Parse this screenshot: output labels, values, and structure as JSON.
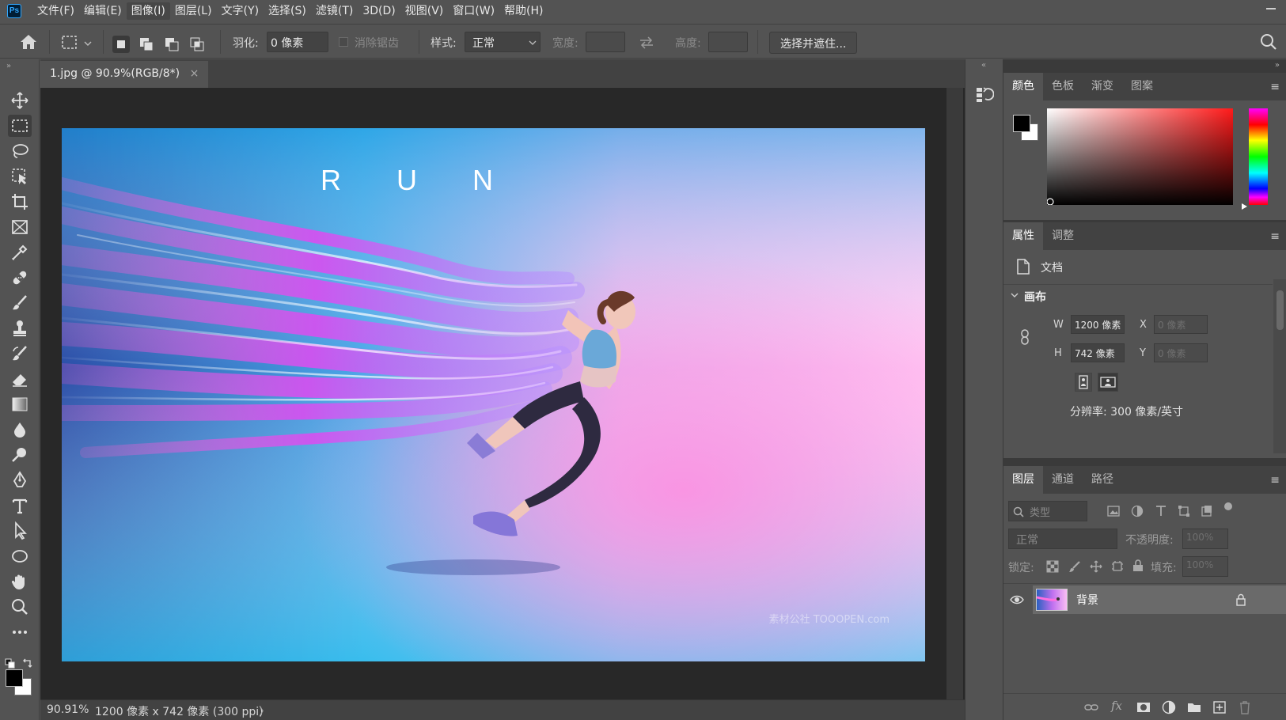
{
  "menu": [
    {
      "label": "文件(F)",
      "active": false
    },
    {
      "label": "编辑(E)",
      "active": false
    },
    {
      "label": "图像(I)",
      "active": true
    },
    {
      "label": "图层(L)",
      "active": false
    },
    {
      "label": "文字(Y)",
      "active": false
    },
    {
      "label": "选择(S)",
      "active": false
    },
    {
      "label": "滤镜(T)",
      "active": false
    },
    {
      "label": "3D(D)",
      "active": false
    },
    {
      "label": "视图(V)",
      "active": false
    },
    {
      "label": "窗口(W)",
      "active": false
    },
    {
      "label": "帮助(H)",
      "active": false
    }
  ],
  "app": {
    "logo": "Ps"
  },
  "options": {
    "feather_label": "羽化:",
    "feather_value": "0 像素",
    "antialias_label": "消除锯齿",
    "style_label": "样式:",
    "style_value": "正常",
    "width_label": "宽度:",
    "height_label": "高度:",
    "select_mask_button": "选择并遮住..."
  },
  "document": {
    "tab_title": "1.jpg @ 90.9%(RGB/8*)",
    "close_glyph": "×",
    "image": {
      "headline": "R U N",
      "watermark": "素材公社 TOOOPEN.com"
    },
    "zoom": "90.91%",
    "doc_info": "1200 像素 x 742 像素 (300 ppi)",
    "status_arrow": "〉"
  },
  "color_panel": {
    "tabs": [
      "颜色",
      "色板",
      "渐变",
      "图案"
    ],
    "active_tab": 0,
    "foreground": "#000000",
    "background": "#ffffff",
    "picker_hue": "#ff2a2a"
  },
  "properties_panel": {
    "tabs": [
      "属性",
      "调整"
    ],
    "active_tab": 0,
    "doc_label": "文档",
    "canvas_section": "画布",
    "w_label": "W",
    "w_value": "1200 像素",
    "h_label": "H",
    "h_value": "742 像素",
    "x_label": "X",
    "x_placeholder": "0 像素",
    "y_label": "Y",
    "y_placeholder": "0 像素",
    "resolution": "分辨率: 300 像素/英寸"
  },
  "layers_panel": {
    "tabs": [
      "图层",
      "通道",
      "路径"
    ],
    "active_tab": 0,
    "filter_placeholder": "类型",
    "blend_mode": "正常",
    "opacity_label": "不透明度:",
    "opacity_value": "100%",
    "lock_label": "锁定:",
    "fill_label": "填充:",
    "fill_value": "100%",
    "layers": [
      {
        "name": "背景",
        "visible": true,
        "locked": true
      }
    ]
  }
}
